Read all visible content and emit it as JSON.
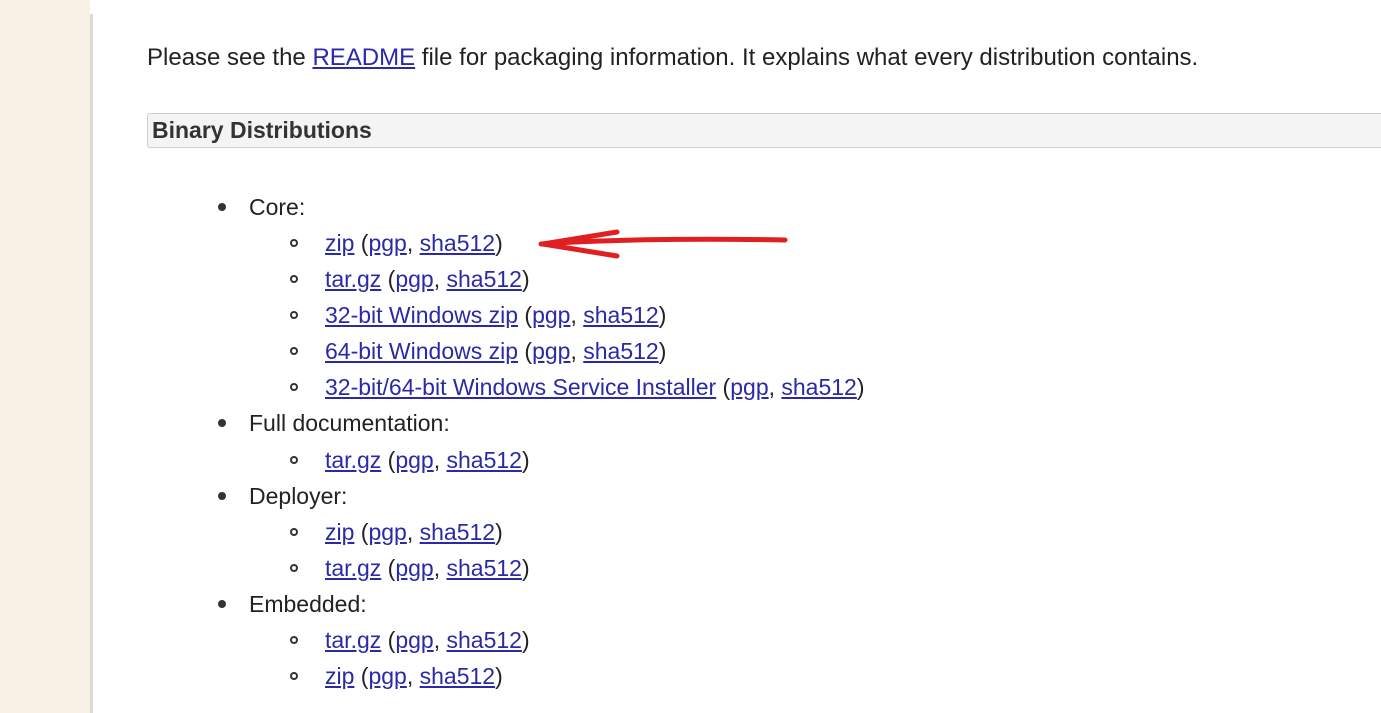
{
  "intro": {
    "prefix": "Please see the ",
    "readme_link": "README",
    "suffix": " file for packaging information. It explains what every distribution contains."
  },
  "section": {
    "title": "Binary Distributions"
  },
  "labels": {
    "pgp": "pgp",
    "sha512": "sha512",
    "open_paren": " (",
    "comma": ", ",
    "close_paren": ")"
  },
  "groups": [
    {
      "label": "Core:",
      "items": [
        {
          "label": "zip"
        },
        {
          "label": "tar.gz"
        },
        {
          "label": "32-bit Windows zip"
        },
        {
          "label": "64-bit Windows zip"
        },
        {
          "label": "32-bit/64-bit Windows Service Installer"
        }
      ]
    },
    {
      "label": "Full documentation:",
      "items": [
        {
          "label": "tar.gz"
        }
      ]
    },
    {
      "label": "Deployer:",
      "items": [
        {
          "label": "zip"
        },
        {
          "label": "tar.gz"
        }
      ]
    },
    {
      "label": "Embedded:",
      "items": [
        {
          "label": "tar.gz"
        },
        {
          "label": "zip"
        }
      ]
    }
  ],
  "colors": {
    "link": "#2a29a8",
    "annotation_arrow": "#e02020",
    "gutter": "#f7f1e6"
  }
}
